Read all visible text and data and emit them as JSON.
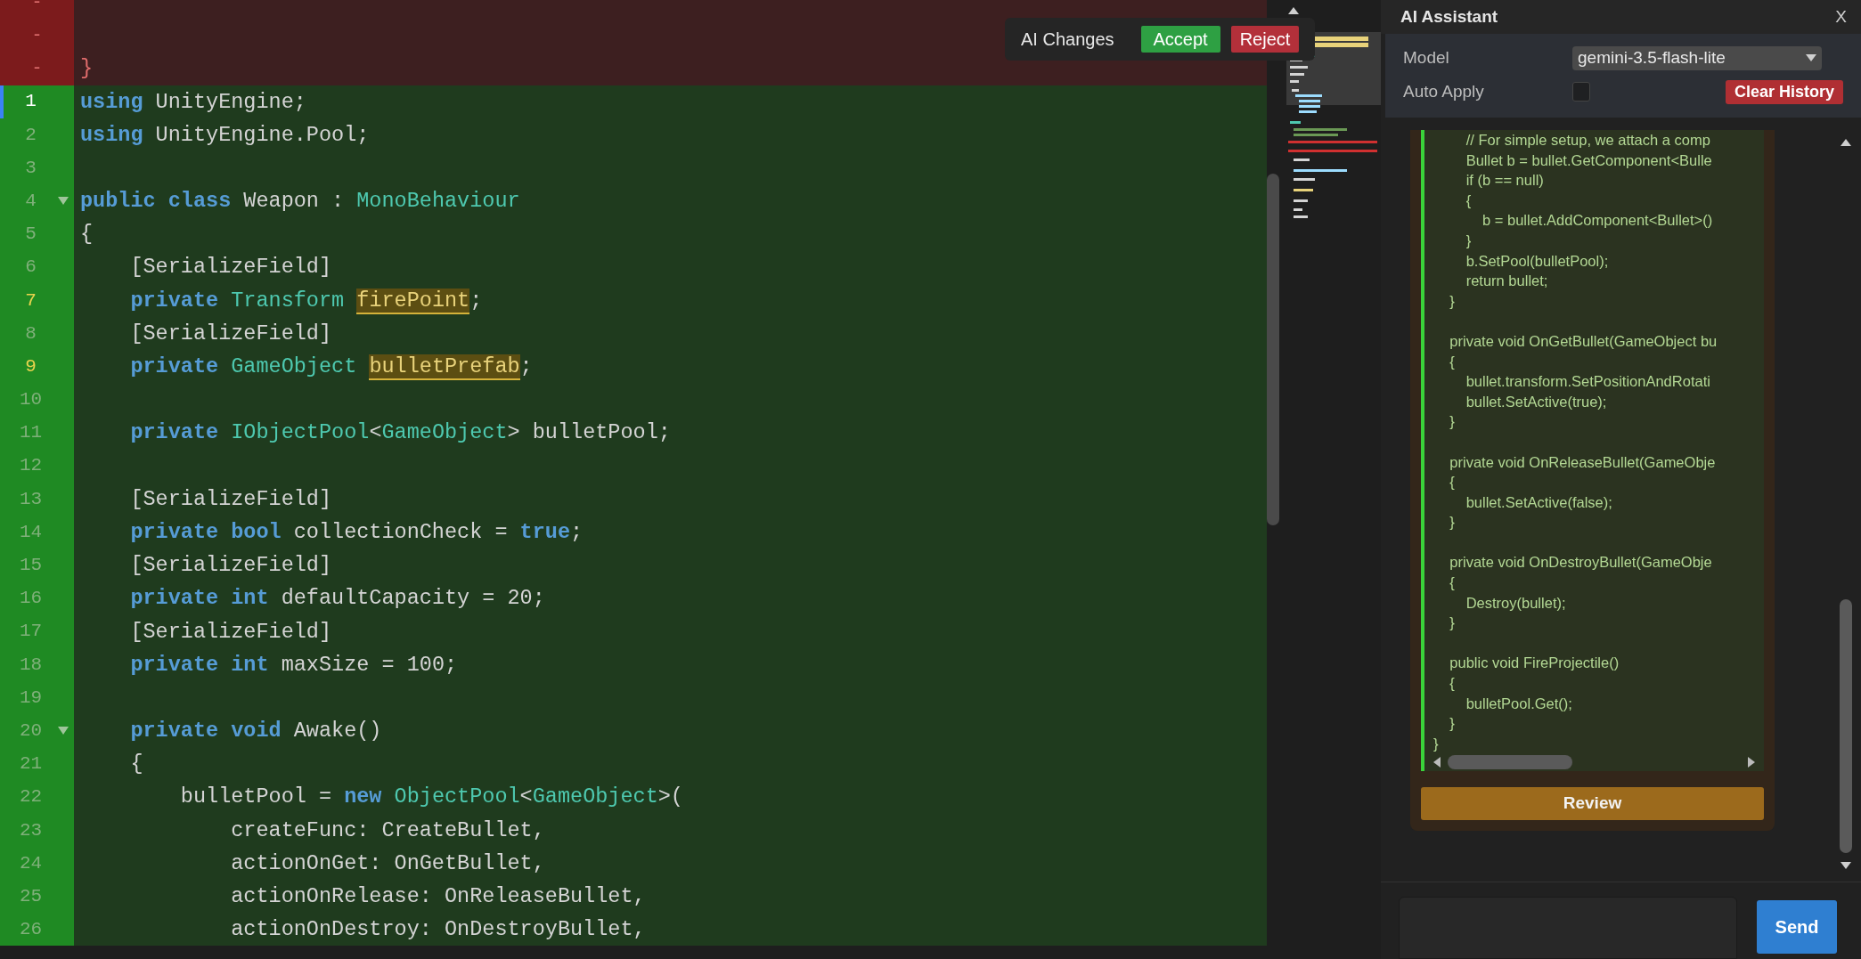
{
  "editor": {
    "deleted_lines": [
      {
        "marker": "-"
      },
      {
        "marker": "-"
      },
      {
        "marker": "-",
        "tokens": [
          {
            "kind": "deleted",
            "text": "}"
          }
        ]
      }
    ],
    "lines": [
      {
        "number": "1",
        "selected": true,
        "highlighted": false,
        "foldable": false,
        "tokens": [
          {
            "kind": "keyword",
            "text": "using"
          },
          {
            "kind": "plain",
            "text": " UnityEngine;"
          }
        ]
      },
      {
        "number": "2",
        "selected": false,
        "highlighted": false,
        "foldable": false,
        "tokens": [
          {
            "kind": "keyword",
            "text": "using"
          },
          {
            "kind": "plain",
            "text": " UnityEngine.Pool;"
          }
        ]
      },
      {
        "number": "3",
        "selected": false,
        "highlighted": false,
        "foldable": false
      },
      {
        "number": "4",
        "selected": false,
        "highlighted": false,
        "foldable": true,
        "tokens": [
          {
            "kind": "keyword",
            "text": "public class"
          },
          {
            "kind": "plain",
            "text": " Weapon : "
          },
          {
            "kind": "type",
            "text": "MonoBehaviour"
          }
        ]
      },
      {
        "number": "5",
        "selected": false,
        "highlighted": false,
        "foldable": false,
        "tokens": [
          {
            "kind": "plain",
            "text": "{"
          }
        ]
      },
      {
        "number": "6",
        "selected": false,
        "highlighted": false,
        "foldable": false,
        "tokens": [
          {
            "kind": "plain",
            "text": "    [SerializeField]"
          }
        ]
      },
      {
        "number": "7",
        "selected": false,
        "highlighted": true,
        "foldable": false,
        "tokens": [
          {
            "kind": "keyword",
            "text": "    private"
          },
          {
            "kind": "type",
            "text": " Transform "
          },
          {
            "kind": "match",
            "text": "firePoint"
          },
          {
            "kind": "plain",
            "text": ";"
          }
        ]
      },
      {
        "number": "8",
        "selected": false,
        "highlighted": false,
        "foldable": false,
        "tokens": [
          {
            "kind": "plain",
            "text": "    [SerializeField]"
          }
        ]
      },
      {
        "number": "9",
        "selected": false,
        "highlighted": true,
        "foldable": false,
        "tokens": [
          {
            "kind": "keyword",
            "text": "    private"
          },
          {
            "kind": "type",
            "text": " GameObject "
          },
          {
            "kind": "match",
            "text": "bulletPrefab"
          },
          {
            "kind": "plain",
            "text": ";"
          }
        ]
      },
      {
        "number": "10",
        "selected": false,
        "highlighted": false,
        "foldable": false
      },
      {
        "number": "11",
        "selected": false,
        "highlighted": false,
        "foldable": false,
        "tokens": [
          {
            "kind": "keyword",
            "text": "    private"
          },
          {
            "kind": "type",
            "text": " IObjectPool"
          },
          {
            "kind": "plain",
            "text": "<"
          },
          {
            "kind": "type",
            "text": "GameObject"
          },
          {
            "kind": "plain",
            "text": "> bulletPool;"
          }
        ]
      },
      {
        "number": "12",
        "selected": false,
        "highlighted": false,
        "foldable": false
      },
      {
        "number": "13",
        "selected": false,
        "highlighted": false,
        "foldable": false,
        "tokens": [
          {
            "kind": "plain",
            "text": "    [SerializeField]"
          }
        ]
      },
      {
        "number": "14",
        "selected": false,
        "highlighted": false,
        "foldable": false,
        "tokens": [
          {
            "kind": "keyword",
            "text": "    private bool"
          },
          {
            "kind": "plain",
            "text": " collectionCheck = "
          },
          {
            "kind": "keyword",
            "text": "true"
          },
          {
            "kind": "plain",
            "text": ";"
          }
        ]
      },
      {
        "number": "15",
        "selected": false,
        "highlighted": false,
        "foldable": false,
        "tokens": [
          {
            "kind": "plain",
            "text": "    [SerializeField]"
          }
        ]
      },
      {
        "number": "16",
        "selected": false,
        "highlighted": false,
        "foldable": false,
        "tokens": [
          {
            "kind": "keyword",
            "text": "    private int"
          },
          {
            "kind": "plain",
            "text": " defaultCapacity = 20;"
          }
        ]
      },
      {
        "number": "17",
        "selected": false,
        "highlighted": false,
        "foldable": false,
        "tokens": [
          {
            "kind": "plain",
            "text": "    [SerializeField]"
          }
        ]
      },
      {
        "number": "18",
        "selected": false,
        "highlighted": false,
        "foldable": false,
        "tokens": [
          {
            "kind": "keyword",
            "text": "    private int"
          },
          {
            "kind": "plain",
            "text": " maxSize = 100;"
          }
        ]
      },
      {
        "number": "19",
        "selected": false,
        "highlighted": false,
        "foldable": false
      },
      {
        "number": "20",
        "selected": false,
        "highlighted": false,
        "foldable": true,
        "tokens": [
          {
            "kind": "keyword",
            "text": "    private void"
          },
          {
            "kind": "plain",
            "text": " Awake()"
          }
        ]
      },
      {
        "number": "21",
        "selected": false,
        "highlighted": false,
        "foldable": false,
        "tokens": [
          {
            "kind": "plain",
            "text": "    {"
          }
        ]
      },
      {
        "number": "22",
        "selected": false,
        "highlighted": false,
        "foldable": false,
        "tokens": [
          {
            "kind": "plain",
            "text": "        bulletPool = "
          },
          {
            "kind": "keyword",
            "text": "new"
          },
          {
            "kind": "type",
            "text": " ObjectPool"
          },
          {
            "kind": "plain",
            "text": "<"
          },
          {
            "kind": "type",
            "text": "GameObject"
          },
          {
            "kind": "plain",
            "text": ">("
          }
        ]
      },
      {
        "number": "23",
        "selected": false,
        "highlighted": false,
        "foldable": false,
        "tokens": [
          {
            "kind": "plain",
            "text": "            createFunc: CreateBullet,"
          }
        ]
      },
      {
        "number": "24",
        "selected": false,
        "highlighted": false,
        "foldable": false,
        "tokens": [
          {
            "kind": "plain",
            "text": "            actionOnGet: OnGetBullet,"
          }
        ]
      },
      {
        "number": "25",
        "selected": false,
        "highlighted": false,
        "foldable": false,
        "tokens": [
          {
            "kind": "plain",
            "text": "            actionOnRelease: OnReleaseBullet,"
          }
        ]
      },
      {
        "number": "26",
        "selected": false,
        "highlighted": false,
        "foldable": false,
        "tokens": [
          {
            "kind": "plain",
            "text": "            actionOnDestroy: OnDestroyBullet,"
          }
        ]
      }
    ]
  },
  "ai_changes": {
    "label": "AI Changes",
    "accept_button": "Accept",
    "reject_button": "Reject"
  },
  "ai_panel": {
    "title": "AI Assistant",
    "close_button": "X",
    "model": {
      "label": "Model",
      "value": "gemini-3.5-flash-lite"
    },
    "auto_apply": {
      "label": "Auto Apply",
      "checked": false
    },
    "clear_button": "Clear History",
    "code_groups": [
      {
        "lines": [
          "        // For simple setup, we attach a comp",
          "        Bullet b = bullet.GetComponent<Bulle",
          "        if (b == null)",
          "        {",
          "            b = bullet.AddComponent<Bullet>()",
          "        }",
          "        b.SetPool(bulletPool);",
          "        return bullet;",
          "    }"
        ]
      },
      {
        "lines": [
          "    private void OnGetBullet(GameObject bu",
          "    {",
          "        bullet.transform.SetPositionAndRotati",
          "        bullet.SetActive(true);",
          "    }"
        ]
      },
      {
        "lines": [
          "    private void OnReleaseBullet(GameObje",
          "    {",
          "        bullet.SetActive(false);",
          "    }"
        ]
      },
      {
        "lines": [
          "    private void OnDestroyBullet(GameObje",
          "    {",
          "        Destroy(bullet);",
          "    }"
        ]
      },
      {
        "lines": [
          "    public void FireProjectile()",
          "    {",
          "        bulletPool.Get();",
          "    }",
          "}"
        ]
      }
    ],
    "review_button": "Review",
    "send_button": "Send"
  }
}
